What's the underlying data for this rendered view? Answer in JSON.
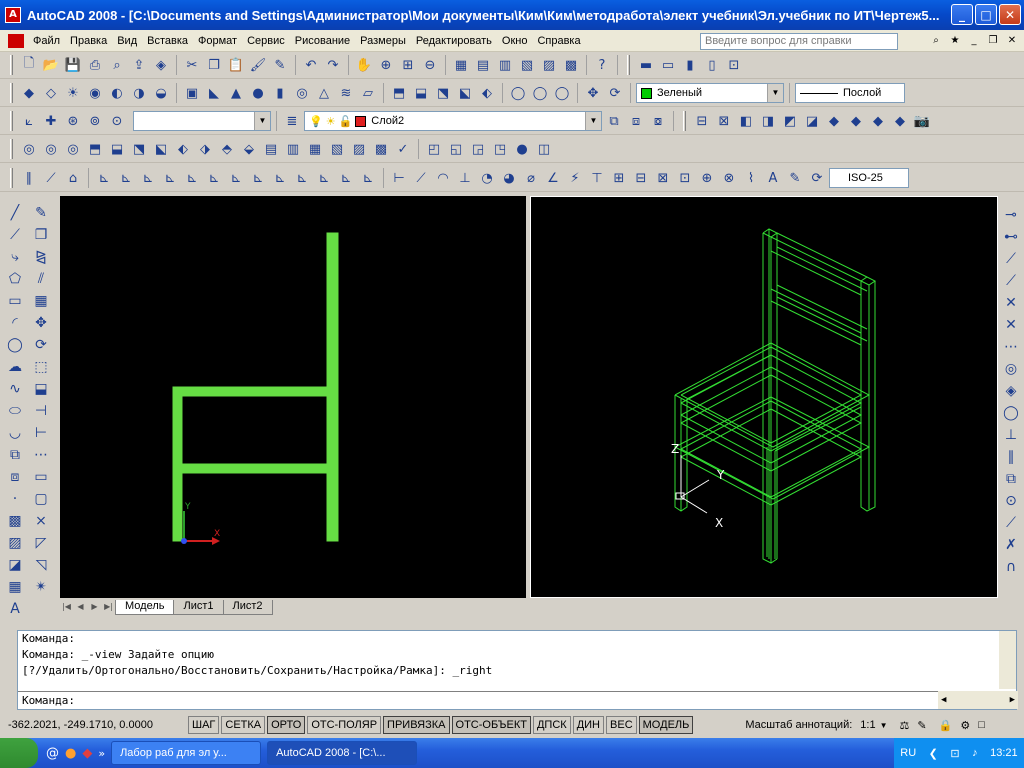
{
  "window": {
    "title": "AutoCAD 2008 - [C:\\Documents and Settings\\Администратор\\Мои документы\\Ким\\Ким\\методработа\\элект учебник\\Эл.учебник по ИТ\\Чертеж5..."
  },
  "menu": {
    "items": [
      "Файл",
      "Правка",
      "Вид",
      "Вставка",
      "Формат",
      "Сервис",
      "Рисование",
      "Размеры",
      "Редактировать",
      "Окно",
      "Справка"
    ],
    "help_placeholder": "Введите вопрос для справки"
  },
  "properties": {
    "color_value": "Зеленый",
    "color_swatch": "#00cc00",
    "linetype_value": "Послой",
    "layer_value": "Слой2",
    "dimstyle_value": "ISO-25"
  },
  "tabs": {
    "items": [
      "Модель",
      "Лист1",
      "Лист2"
    ],
    "active": "Модель"
  },
  "viewports": {
    "left_axis_y": "Y",
    "left_axis_x": "X",
    "right_axis_z": "Z",
    "right_axis_y": "Y",
    "right_axis_x": "X",
    "drawing_color": "#66dd44"
  },
  "command": {
    "lines": [
      "Команда:",
      "Команда: _-view Задайте опцию",
      "[?/Удалить/Ортогонально/Восстановить/Сохранить/Настройка/Рамка]: _right"
    ],
    "prompt": "Команда:"
  },
  "status": {
    "coords": "-362.2021, -249.1710, 0.0000",
    "buttons": [
      "ШАГ",
      "СЕТКА",
      "ОРТО",
      "ОТС-ПОЛЯР",
      "ПРИВЯЗКА",
      "ОТС-ОБЪЕКТ",
      "ДПСК",
      "ДИН",
      "ВЕС",
      "МОДЕЛЬ"
    ],
    "annotation_scale_label": "Масштаб аннотаций:",
    "annotation_scale_value": "1:1"
  },
  "taskbar": {
    "tasks": [
      "Лабор раб для эл у...",
      "AutoCAD 2008 - [C:\\..."
    ],
    "lang": "RU",
    "clock": "13:21"
  }
}
